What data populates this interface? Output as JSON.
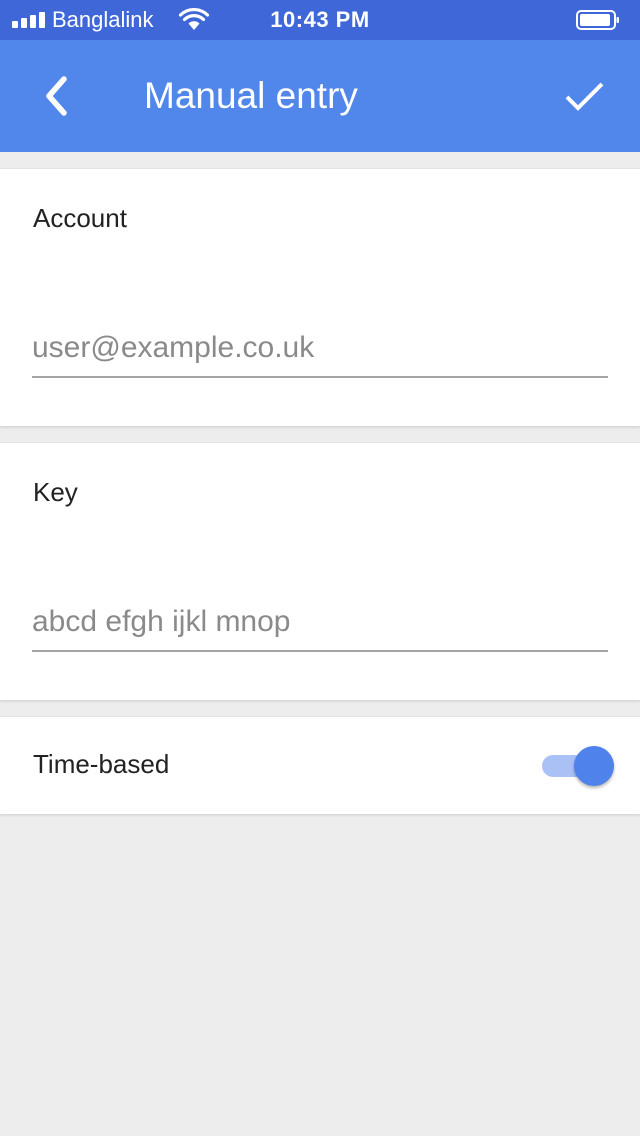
{
  "status_bar": {
    "carrier": "Banglalink",
    "time": "10:43 PM",
    "icons": [
      "signal-icon",
      "wifi-icon",
      "battery-icon"
    ]
  },
  "app_bar": {
    "title": "Manual entry",
    "back_icon": "chevron-left-icon",
    "confirm_icon": "check-icon",
    "color": "#5187ea"
  },
  "account": {
    "label": "Account",
    "value": "",
    "placeholder": "user@example.co.uk"
  },
  "key": {
    "label": "Key",
    "value": "",
    "placeholder": "abcd efgh ijkl mnop"
  },
  "time_based": {
    "label": "Time-based",
    "enabled": true,
    "accent": "#4f82ea"
  }
}
